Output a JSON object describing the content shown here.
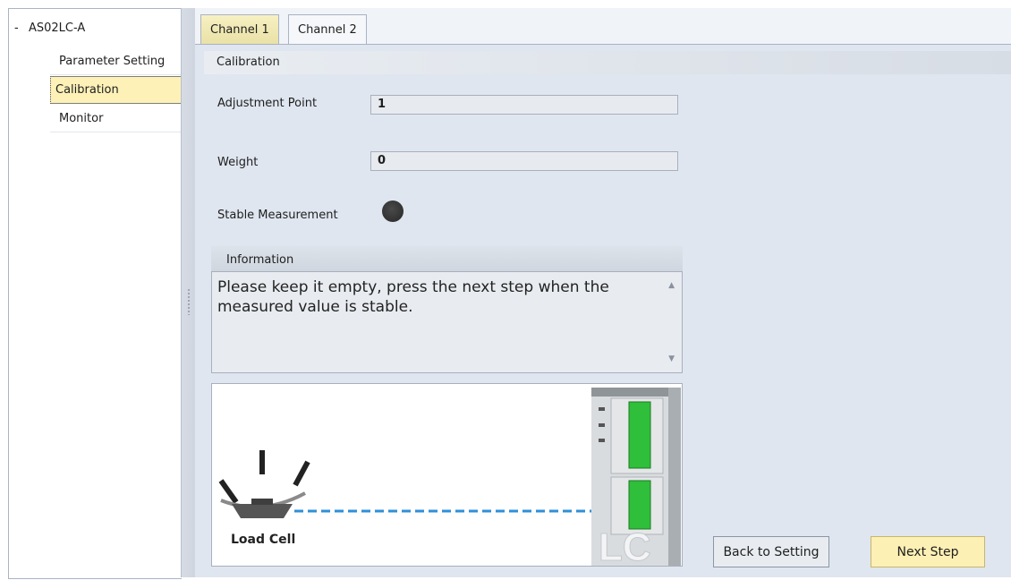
{
  "tree": {
    "root_toggle": "-",
    "root_label": "AS02LC-A",
    "items": [
      {
        "label": "Parameter Setting"
      },
      {
        "label": "Calibration"
      },
      {
        "label": "Monitor"
      }
    ],
    "selected_index": 1
  },
  "tabs": [
    {
      "label": "Channel 1"
    },
    {
      "label": "Channel 2"
    }
  ],
  "section_title": "Calibration",
  "fields": {
    "adjustment_point": {
      "label": "Adjustment Point",
      "value": "1"
    },
    "weight": {
      "label": "Weight",
      "value": "0"
    },
    "stable_measurement": {
      "label": "Stable Measurement",
      "status_color": "#2e2e2e"
    }
  },
  "information": {
    "title": "Information",
    "text": "Please keep it empty, press the next step when the measured value is stable."
  },
  "illustration": {
    "load_cell_label": "Load Cell",
    "module_label": "LC"
  },
  "buttons": {
    "back": "Back to Setting",
    "next": "Next Step"
  },
  "colors": {
    "selection": "#fdf1b8",
    "active_tab": "#f1eab0",
    "terminal_green": "#2fbf3a",
    "cable_blue": "#2f8fd8"
  }
}
